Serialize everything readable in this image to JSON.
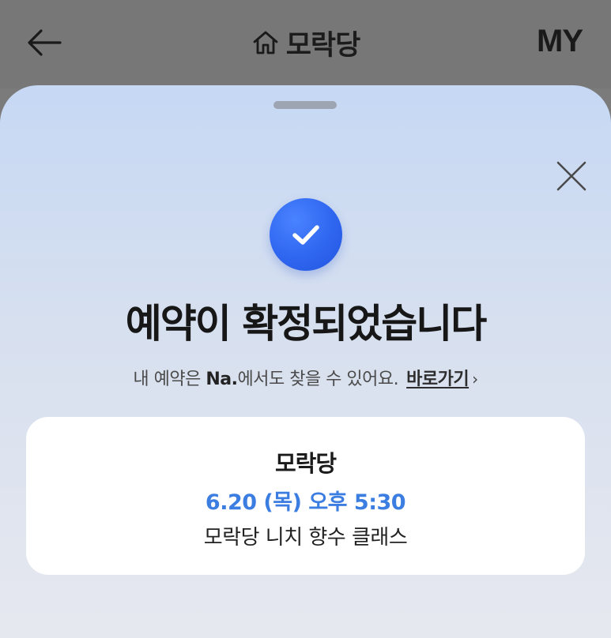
{
  "header": {
    "title": "모락당",
    "right_label": "MY"
  },
  "sheet": {
    "headline": "예약이 확정되었습니다",
    "sub_prefix": "내 예약은 ",
    "sub_brand": "Na.",
    "sub_suffix": "에서도 찾을 수 있어요.",
    "goto_label": "바로가기",
    "goto_chevron": "›"
  },
  "reservation": {
    "shop_name": "모락당",
    "datetime": "6.20 (목) 오후 5:30",
    "class_name": "모락당 니치 향수 클래스"
  },
  "colors": {
    "accent_blue": "#2f66f0",
    "date_blue": "#3b7de0"
  },
  "icons": {
    "back": "arrow-left-icon",
    "home": "home-icon",
    "close": "close-icon",
    "check": "check-icon"
  }
}
